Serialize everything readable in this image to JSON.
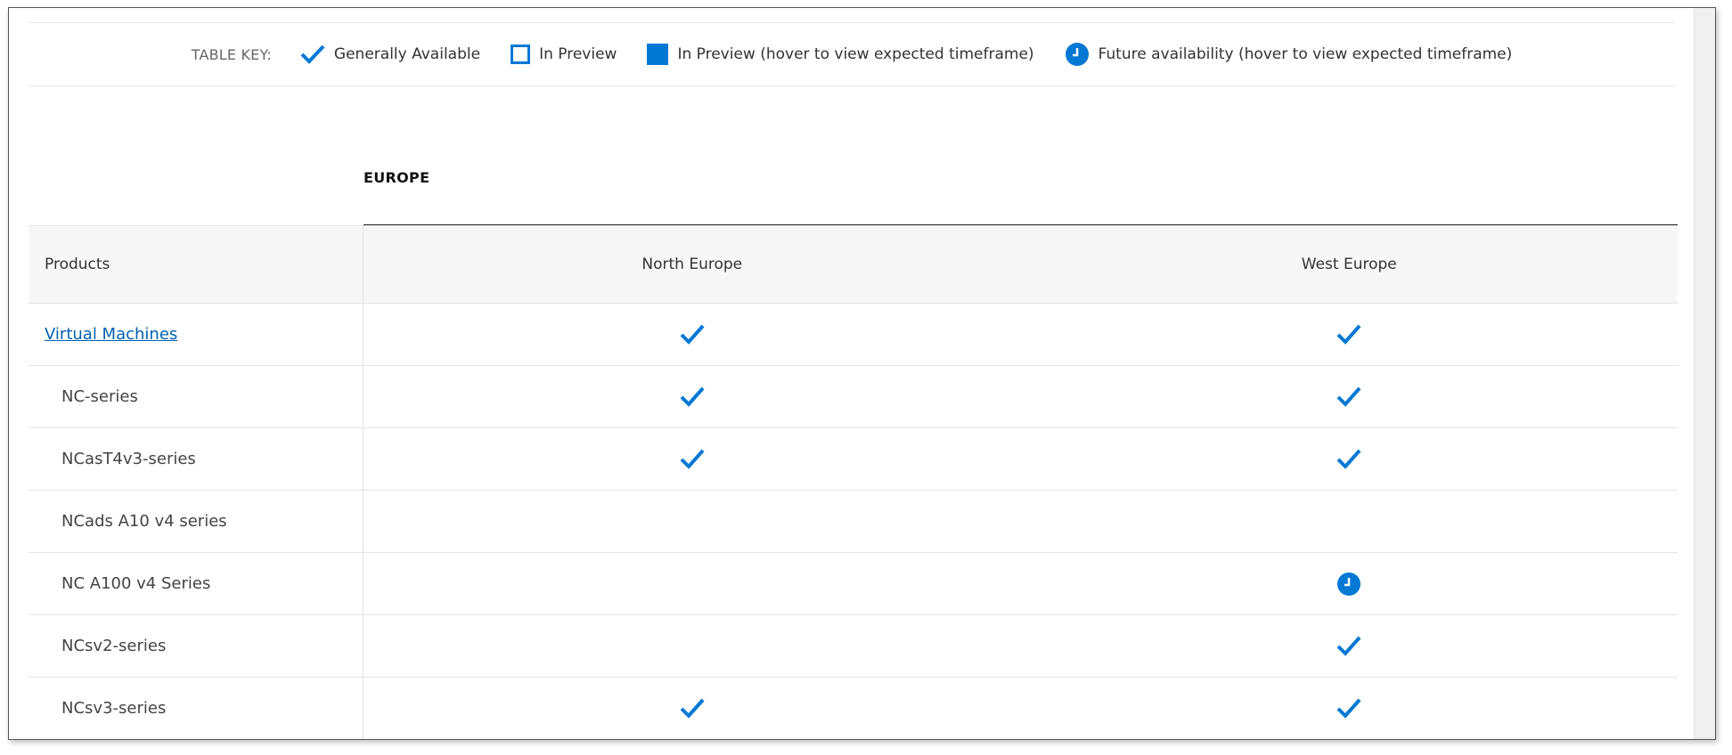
{
  "legend": {
    "title": "TABLE KEY:",
    "items": [
      {
        "icon": "check-icon",
        "label": "Generally Available"
      },
      {
        "icon": "preview-outline-icon",
        "label": "In Preview"
      },
      {
        "icon": "preview-filled-icon",
        "label": "In Preview (hover to view expected timeframe)"
      },
      {
        "icon": "clock-icon",
        "label": "Future availability (hover to view expected timeframe)"
      }
    ]
  },
  "region": {
    "name": "EUROPE",
    "columns": [
      "North Europe",
      "West Europe"
    ]
  },
  "table": {
    "products_header": "Products",
    "rows": [
      {
        "product": "Virtual Machines",
        "link": true,
        "status": [
          "available",
          "available"
        ]
      },
      {
        "product": "NC-series",
        "status": [
          "available",
          "available"
        ]
      },
      {
        "product": "NCasT4v3-series",
        "status": [
          "available",
          "available"
        ]
      },
      {
        "product": "NCads A10 v4 series",
        "status": [
          "none",
          "none"
        ]
      },
      {
        "product": "NC A100 v4 Series",
        "status": [
          "none",
          "future"
        ]
      },
      {
        "product": "NCsv2-series",
        "status": [
          "none",
          "available"
        ]
      },
      {
        "product": "NCsv3-series",
        "status": [
          "available",
          "available"
        ]
      }
    ]
  },
  "colors": {
    "accent": "#0078d4",
    "link": "#0062b1",
    "rule": "#222222"
  }
}
